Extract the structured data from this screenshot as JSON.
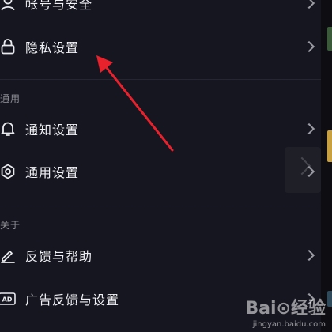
{
  "settings": {
    "rows": [
      {
        "label": "帐号与安全",
        "icon": "user-icon"
      },
      {
        "label": "隐私设置",
        "icon": "lock-icon"
      },
      {
        "label": "通知设置",
        "icon": "bell-icon"
      },
      {
        "label": "通用设置",
        "icon": "gear-icon"
      },
      {
        "label": "反馈与帮助",
        "icon": "edit-icon"
      },
      {
        "label": "广告反馈与设置",
        "icon": "ad-icon",
        "icon_text": "AD"
      }
    ],
    "sections": {
      "general": "通用",
      "about": "关于"
    }
  },
  "watermark": {
    "brand": "Bai⊙经验",
    "url": "jingyan.baidu.com"
  },
  "colors": {
    "background": "#161620",
    "text": "#f1f2f5",
    "muted": "#8c8d95",
    "arrow": "#e8222c"
  }
}
